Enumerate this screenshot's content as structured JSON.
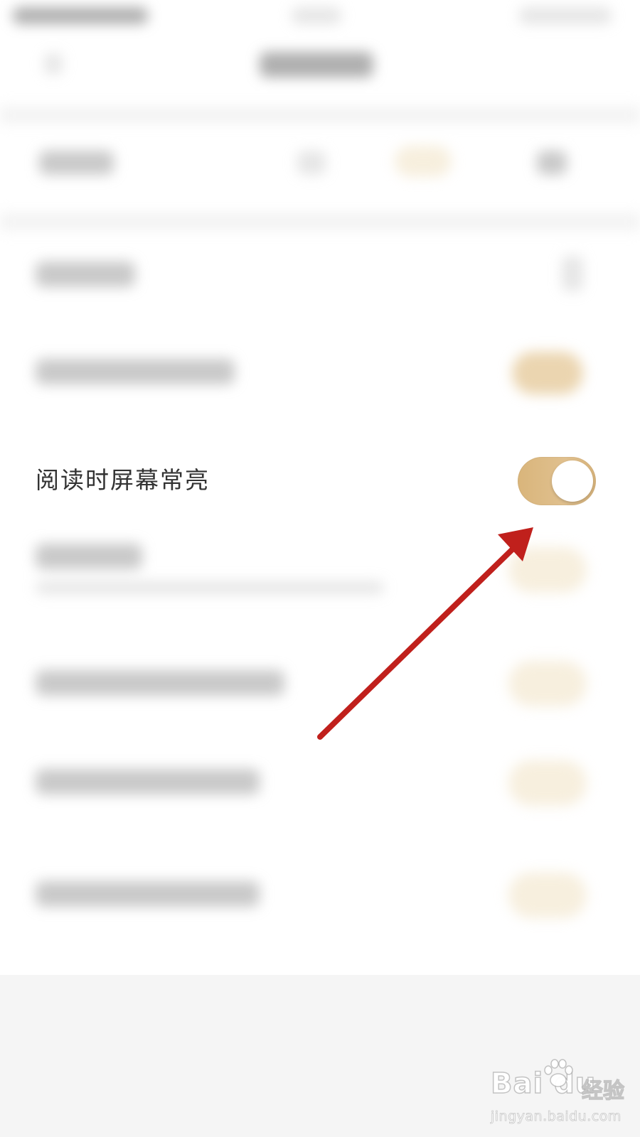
{
  "settings": {
    "keep_screen_on_label": "阅读时屏幕常亮",
    "keep_screen_on_state": true
  },
  "colors": {
    "toggle_on": "#DFBE8A",
    "arrow": "#C0201C",
    "background": "#FFFFFF"
  },
  "watermark": {
    "logo": "Bai du",
    "brand": "经验",
    "url": "jingyan.baidu.com"
  },
  "icons": {
    "annotation": "red-arrow-icon",
    "watermark_paw": "baidu-paw-icon"
  }
}
